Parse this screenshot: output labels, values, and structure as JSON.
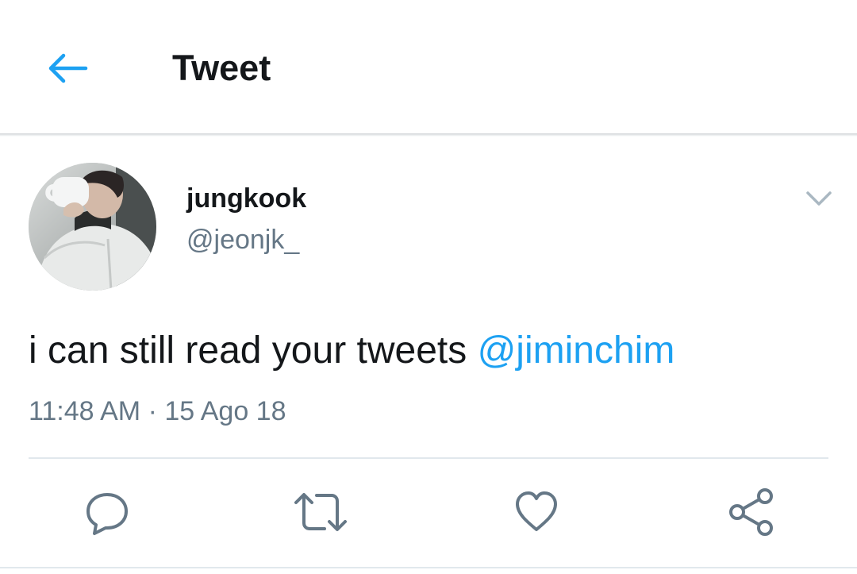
{
  "header": {
    "back_icon": "arrow-left-icon",
    "title": "Tweet"
  },
  "tweet": {
    "author": {
      "name": "jungkook",
      "handle": "@jeonjk_",
      "avatar": "profile-photo"
    },
    "text": "i can still read your tweets ",
    "mention": "@jiminchim",
    "timestamp": "11:48 AM · 15 Ago 18",
    "menu_icon": "chevron-down-icon"
  },
  "actions": [
    {
      "icon": "reply-icon"
    },
    {
      "icon": "retweet-icon"
    },
    {
      "icon": "heart-icon"
    },
    {
      "icon": "share-icon"
    }
  ],
  "colors": {
    "accent": "#1da1f2",
    "text_primary": "#14171a",
    "text_secondary": "#657786",
    "icon_gray": "#657786",
    "divider": "#e1e8ed"
  }
}
